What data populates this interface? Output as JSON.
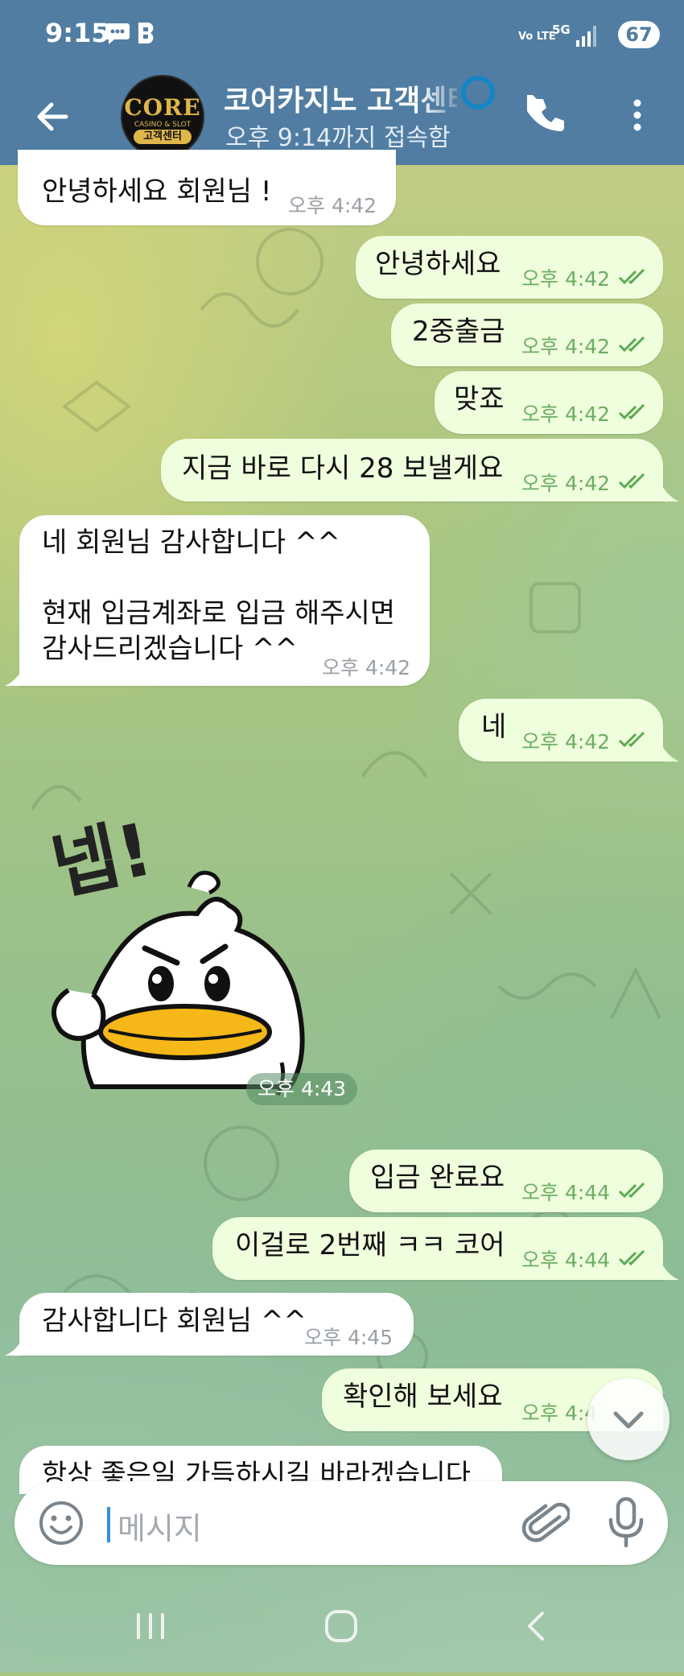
{
  "status_bar": {
    "time": "9:15",
    "network_label": "Vo LTE",
    "network_gen": "5G",
    "battery": "67"
  },
  "header": {
    "avatar_logo": "CORE",
    "avatar_tagline": "CASINO & SLOT",
    "avatar_badge": "고객센터",
    "title": "코어카지노 고객센터",
    "subtitle": "오후 9:14까지 접속함"
  },
  "messages": [
    {
      "direction": "in",
      "text": "안녕하세요 회원님 !",
      "time": "오후 4:42"
    },
    {
      "direction": "out",
      "text": "안녕하세요",
      "time": "오후 4:42",
      "read": true
    },
    {
      "direction": "out",
      "text": "2중출금",
      "time": "오후 4:42",
      "read": true
    },
    {
      "direction": "out",
      "text": "맞죠",
      "time": "오후 4:42",
      "read": true
    },
    {
      "direction": "out",
      "text": "지금 바로 다시 28 보낼게요",
      "time": "오후 4:42",
      "read": true
    },
    {
      "direction": "in",
      "text": "네 회원님 감사합니다 ^^\n\n현재 입금계좌로 입금 해주시면\n감사드리겠습니다 ^^",
      "time": "오후 4:42"
    },
    {
      "direction": "out",
      "text": "네",
      "time": "오후 4:42",
      "read": true
    },
    {
      "direction": "in",
      "type": "sticker",
      "sticker_text": "넵!",
      "time": "오후 4:43"
    },
    {
      "direction": "out",
      "text": "입금 완료요",
      "time": "오후 4:44",
      "read": true
    },
    {
      "direction": "out",
      "text": "이걸로 2번째 ㅋㅋ 코어",
      "time": "오후 4:44",
      "read": true
    },
    {
      "direction": "in",
      "text": "감사합니다 회원님 ^^",
      "time": "오후 4:45"
    },
    {
      "direction": "out",
      "text": "확인해 보세요",
      "time": "오후 4:4",
      "read": true
    },
    {
      "direction": "in",
      "text": "항상 좋은일 가득하시길 바라겠습니다",
      "time": ""
    }
  ],
  "composer": {
    "placeholder": "메시지"
  },
  "colors": {
    "header_bg": "#517da2",
    "incoming_bubble": "#ffffff",
    "outgoing_bubble": "#effedd",
    "outgoing_time": "#6cae63",
    "read_check": "#5daa54"
  },
  "icons": [
    "back-arrow-icon",
    "phone-icon",
    "more-vert-icon",
    "emoji-icon",
    "attach-icon",
    "mic-icon",
    "chevron-down-icon",
    "double-check-icon"
  ]
}
